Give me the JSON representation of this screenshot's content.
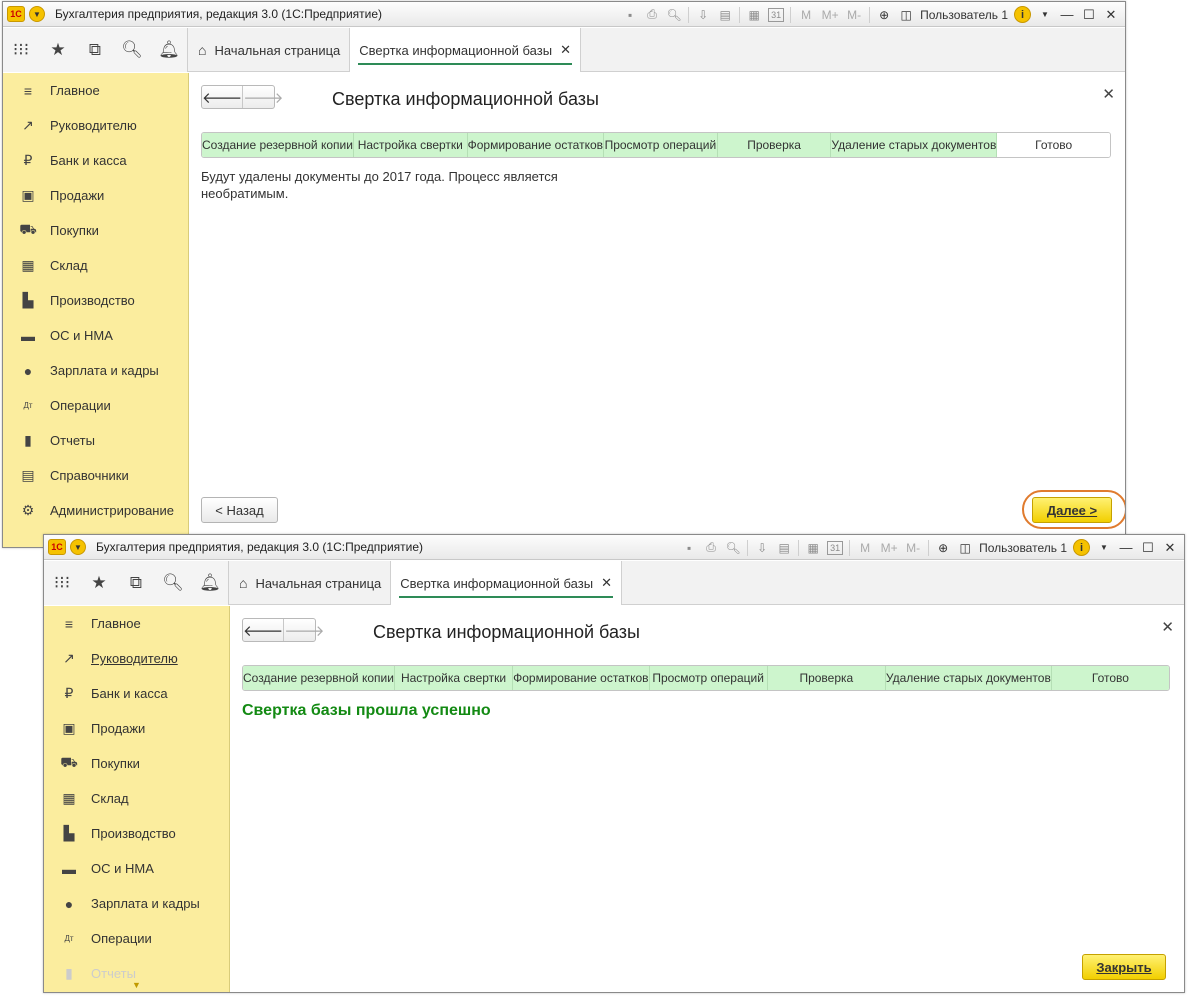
{
  "app_title": "Бухгалтерия предприятия, редакция 3.0  (1С:Предприятие)",
  "logo_text": "1С",
  "user_name": "Пользователь 1",
  "toolbar_text": [
    "M",
    "M+",
    "M-"
  ],
  "calendar_day": "31",
  "tabs": {
    "home": "Начальная страница",
    "active": "Свертка информационной базы"
  },
  "sidebar_items": [
    {
      "label": "Главное",
      "icon": "≡"
    },
    {
      "label": "Руководителю",
      "icon": "↗"
    },
    {
      "label": "Банк и касса",
      "icon": "₽"
    },
    {
      "label": "Продажи",
      "icon": "▣"
    },
    {
      "label": "Покупки",
      "icon": "⛟"
    },
    {
      "label": "Склад",
      "icon": "▦"
    },
    {
      "label": "Производство",
      "icon": "▙"
    },
    {
      "label": "ОС и НМА",
      "icon": "▬"
    },
    {
      "label": "Зарплата и кадры",
      "icon": "●"
    },
    {
      "label": "Операции",
      "icon": "Дт"
    },
    {
      "label": "Отчеты",
      "icon": "▮"
    },
    {
      "label": "Справочники",
      "icon": "▤"
    },
    {
      "label": "Администрирование",
      "icon": "⚙"
    }
  ],
  "form_title": "Свертка информационной базы",
  "steps": [
    "Создание резервной копии",
    "Настройка свертки",
    "Формирование остатков",
    "Просмотр операций",
    "Проверка",
    "Удаление старых документов",
    "Готово"
  ],
  "window1": {
    "message_line1": "Будут удалены документы до 2017 года. Процесс является",
    "message_line2": "необратимым.",
    "back_button": "< Назад",
    "next_button": "Далее >",
    "highlight_color": "#e07b2e"
  },
  "window2": {
    "success_message": "Свертка базы прошла успешно",
    "close_button": "Закрыть",
    "success_color": "#138a13"
  }
}
